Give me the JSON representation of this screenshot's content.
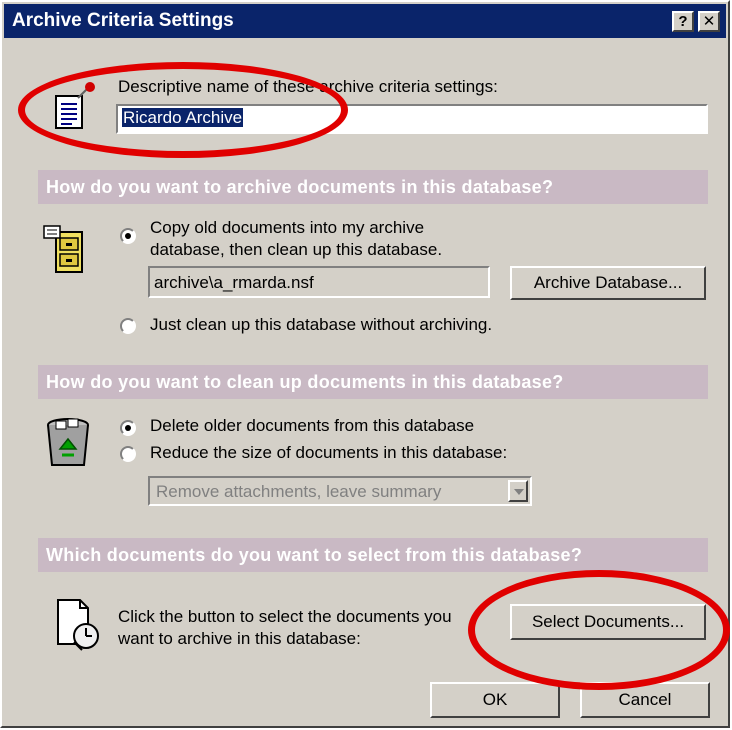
{
  "window": {
    "title": "Archive Criteria Settings",
    "help_button": "?",
    "close_button": "✕"
  },
  "name_section": {
    "label": "Descriptive name of these archive criteria settings:",
    "value": "Ricardo Archive"
  },
  "archive_section": {
    "header": "How do you want to archive documents in this database?",
    "option_copy_line1": "Copy old documents into my archive",
    "option_copy_line2": "database, then clean up this database.",
    "archive_path": "archive\\a_rmarda.nsf",
    "archive_db_button": "Archive Database...",
    "option_clean_only": "Just clean up this database without archiving.",
    "selected_option": "copy"
  },
  "cleanup_section": {
    "header": "How do you want to clean up documents in this database?",
    "option_delete": "Delete older documents from this database",
    "option_reduce": "Reduce the size of documents in this database:",
    "reduce_dropdown_value": "Remove attachments, leave summary",
    "selected_option": "delete"
  },
  "select_section": {
    "header": "Which documents do you want to select from this database?",
    "instruction_line1": "Click the button to select the documents you",
    "instruction_line2": "want to archive in this database:",
    "select_button": "Select Documents..."
  },
  "footer": {
    "ok_button": "OK",
    "cancel_button": "Cancel"
  },
  "colors": {
    "titlebar": "#0a246a",
    "dialog_bg": "#d4d0c8",
    "section_header_bg": "#c9b9c4",
    "annotation": "#e00000"
  }
}
